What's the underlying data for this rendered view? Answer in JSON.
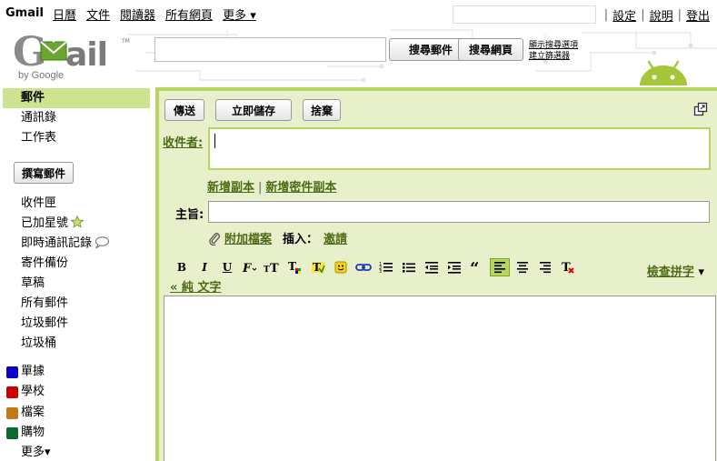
{
  "topbar": {
    "brand": "Gmail",
    "links": [
      "日曆",
      "文件",
      "閱讀器",
      "所有網頁"
    ],
    "more": "更多 ▾",
    "right_links": [
      "設定",
      "說明",
      "登出"
    ]
  },
  "header": {
    "logo_text": "Gmail",
    "logo_by": "by Google",
    "search_mail_button": "搜尋郵件",
    "search_web_button": "搜尋網頁",
    "show_search_options": "顯示搜尋選項",
    "create_filter": "建立篩選器"
  },
  "sidebar": {
    "top_items": [
      "郵件",
      "通訊錄",
      "工作表"
    ],
    "compose": "撰寫郵件",
    "folders": [
      "收件匣",
      "已加星號",
      "即時通訊記錄",
      "寄件備份",
      "草稿",
      "所有郵件",
      "垃圾郵件",
      "垃圾桶"
    ],
    "labels": [
      {
        "name": "單據",
        "color": "#0b00c8"
      },
      {
        "name": "學校",
        "color": "#cc0000"
      },
      {
        "name": "檔案",
        "color": "#c27a17"
      },
      {
        "name": "購物",
        "color": "#0b6b2c"
      }
    ],
    "more": "更多▾"
  },
  "compose": {
    "send": "傳送",
    "save_now": "立即儲存",
    "discard": "捨棄",
    "to_label": "收件者:",
    "add_cc": "新增副本",
    "add_bcc": "新增密件副本",
    "subject_label": "主旨:",
    "attach": "附加檔案",
    "insert_label": "插入：",
    "invite": "邀請",
    "spell_check": "檢查拼字",
    "plain_text": "« 純 文字"
  }
}
